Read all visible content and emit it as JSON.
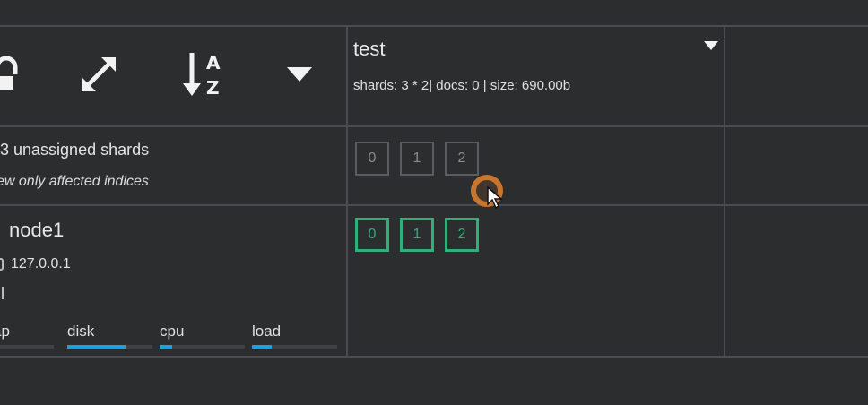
{
  "index": {
    "name": "test",
    "stats": "shards: 3 * 2| docs: 0 | size: 690.00b"
  },
  "unassigned": {
    "summary": "3 unassigned shards",
    "filter_label": "ew only affected indices",
    "shards": [
      "0",
      "1",
      "2"
    ]
  },
  "node": {
    "name": "node1",
    "ip": "127.0.0.1",
    "metrics": [
      {
        "label": "ap",
        "level": 0
      },
      {
        "label": "disk",
        "level": 0.68
      },
      {
        "label": "cpu",
        "level": 0.15
      },
      {
        "label": "load",
        "level": 0.23
      }
    ],
    "shards": [
      "0",
      "1",
      "2"
    ]
  },
  "colors": {
    "background": "#2b2d2f",
    "grid_line": "#4a4c4f",
    "started_shard": "#2fb07a",
    "unassigned_shard": "#5a5c5f",
    "metric_bar": "#1f9fe0",
    "cursor_highlight": "#c7752f"
  },
  "icons": {
    "lock": "lock-icon",
    "expand": "expand-arrows-icon",
    "sort": "sort-alpha-icon",
    "dropdown": "caret-down-icon",
    "index_menu": "caret-down-icon"
  }
}
